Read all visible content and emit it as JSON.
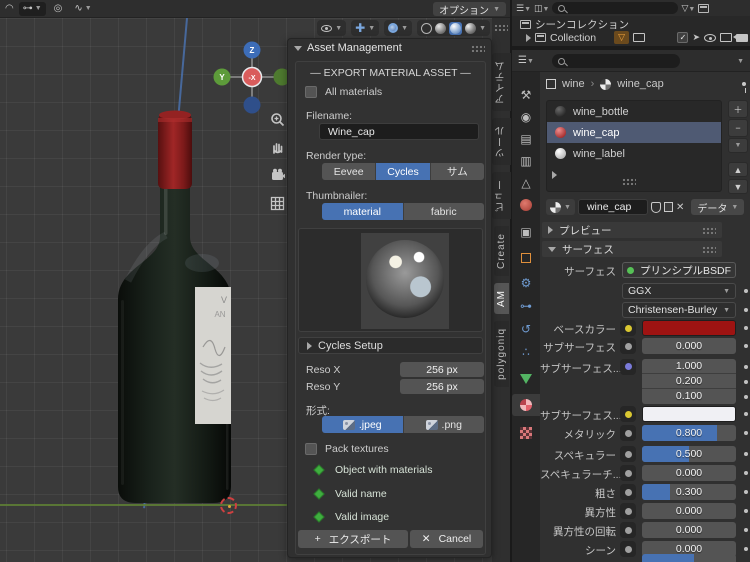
{
  "viewport": {
    "header": {
      "options_button": "オプション",
      "snap_icons": [
        "magnet-icon",
        "snap-target-icon",
        "proportional-editing-icon",
        "falloff-curve-icon"
      ],
      "display_icons": [
        "show-gizmo-icon",
        "show-overlays-icon",
        "toggle-xray-icon"
      ],
      "shading_modes": [
        "wireframe",
        "solid",
        "material-preview",
        "rendered"
      ],
      "active_shading": "material-preview"
    },
    "gizmo": {
      "axis_top": "Z",
      "axis_left": "Y",
      "axis_center": "-X"
    },
    "nav_tools": [
      "zoom-icon",
      "pan-hand-icon",
      "camera-view-icon",
      "grid-ortho-icon"
    ]
  },
  "asset_panel": {
    "title": "Asset Management",
    "section_title": "— EXPORT MATERIAL ASSET —",
    "all_materials_label": "All materials",
    "filename_label": "Filename:",
    "filename_value": "Wine_cap",
    "render_type_label": "Render type:",
    "render_types": [
      "Eevee",
      "Cycles",
      "サム"
    ],
    "render_type_selected": "Cycles",
    "thumbnailer_label": "Thumbnailer:",
    "thumbnailer_options": [
      "material",
      "fabric"
    ],
    "thumbnailer_selected": "material",
    "cycles_setup_label": "Cycles Setup",
    "reso_x_label": "Reso X",
    "reso_x_value": "256 px",
    "reso_y_label": "Reso Y",
    "reso_y_value": "256 px",
    "format_label": "形式:",
    "formats": [
      ".jpeg",
      ".png"
    ],
    "format_selected": ".jpeg",
    "pack_textures_label": "Pack textures",
    "checks": [
      "Object with materials",
      "Valid name",
      "Valid image"
    ],
    "export_label": "エクスポート",
    "cancel_label": "Cancel"
  },
  "side_tabs": {
    "items": [
      "アイテム",
      "ツール",
      "ビュー",
      "Create",
      "AM",
      "polygoniq"
    ],
    "active": "AM"
  },
  "outliner": {
    "scene_collection": "シーンコレクション",
    "collection": "Collection"
  },
  "properties": {
    "breadcrumb": {
      "object": "wine",
      "separator": "›",
      "material": "wine_cap"
    },
    "slots": [
      {
        "name": "wine_bottle",
        "icon": "sphere-dark"
      },
      {
        "name": "wine_cap",
        "icon": "sphere-red"
      },
      {
        "name": "wine_label",
        "icon": "sphere-light"
      }
    ],
    "active_slot": "wine_cap",
    "name_field": "wine_cap",
    "data_menu": "データ",
    "sections": {
      "preview": "プレビュー",
      "surface": "サーフェス"
    },
    "surface_rows": [
      {
        "label": "サーフェス",
        "type": "node_button",
        "value": "プリンシプルBSDF",
        "socket": "#56c156"
      },
      {
        "label": "",
        "type": "dropdown",
        "value": "GGX"
      },
      {
        "label": "",
        "type": "dropdown",
        "value": "Christensen-Burley"
      },
      {
        "label": "ベースカラー",
        "type": "color",
        "color": "#9e1312",
        "socket": "#d9c731"
      },
      {
        "label": "サブサーフェス",
        "type": "slider",
        "value": "0.000",
        "fill": 0,
        "socket": "#a0a0a0"
      },
      {
        "label": "サブサーフェス...",
        "type": "slider",
        "value": "1.000",
        "fill": 0,
        "socket": "#7a7ad9",
        "stack": "top"
      },
      {
        "label": "",
        "type": "slider",
        "value": "0.200",
        "fill": 0,
        "stack": "mid"
      },
      {
        "label": "",
        "type": "slider",
        "value": "0.100",
        "fill": 0,
        "stack": "bottom"
      },
      {
        "label": "サブサーフェス...",
        "type": "color",
        "color": "#f0f0f4",
        "socket": "#d9c731"
      },
      {
        "label": "メタリック",
        "type": "slider",
        "value": "0.800",
        "fill": 80,
        "socket": "#a0a0a0"
      },
      {
        "label": "スペキュラー",
        "type": "slider",
        "value": "0.500",
        "fill": 50,
        "socket": "#a0a0a0"
      },
      {
        "label": "スペキュラーチ...",
        "type": "slider",
        "value": "0.000",
        "fill": 0,
        "socket": "#a0a0a0"
      },
      {
        "label": "粗さ",
        "type": "slider",
        "value": "0.300",
        "fill": 30,
        "socket": "#a0a0a0"
      },
      {
        "label": "異方性",
        "type": "slider",
        "value": "0.000",
        "fill": 0,
        "socket": "#a0a0a0"
      },
      {
        "label": "異方性の回転",
        "type": "slider",
        "value": "0.000",
        "fill": 0,
        "socket": "#a0a0a0"
      },
      {
        "label": "シーン",
        "type": "slider",
        "value": "0.000",
        "fill": 0,
        "socket": "#a0a0a0"
      },
      {
        "label": "",
        "type": "slider",
        "value": "",
        "fill": 55,
        "partial": true
      }
    ],
    "tab_icons": [
      {
        "name": "tool-tab",
        "shape": "glyph",
        "glyph": "⚒",
        "color": "#bdbdbd"
      },
      {
        "name": "render-tab",
        "shape": "glyph",
        "glyph": "◉",
        "color": "#bdbdbd"
      },
      {
        "name": "output-tab",
        "shape": "glyph",
        "glyph": "▤",
        "color": "#bdbdbd"
      },
      {
        "name": "view-layer-tab",
        "shape": "glyph",
        "glyph": "▥",
        "color": "#bdbdbd"
      },
      {
        "name": "scene-tab",
        "shape": "glyph",
        "glyph": "△",
        "color": "#bdbdbd"
      },
      {
        "name": "world-tab",
        "shape": "world"
      },
      {
        "name": "collection-tab",
        "shape": "glyph",
        "glyph": "▣",
        "color": "#bdbdbd"
      },
      {
        "name": "object-tab",
        "shape": "square"
      },
      {
        "name": "modifiers-tab",
        "shape": "glyph",
        "glyph": "⚙",
        "color": "#6f9bd1"
      },
      {
        "name": "constraints-tab",
        "shape": "glyph",
        "glyph": "⊶",
        "color": "#6f9bd1"
      },
      {
        "name": "physics-tab",
        "shape": "glyph",
        "glyph": "↺",
        "color": "#6f9bd1"
      },
      {
        "name": "particles-tab",
        "shape": "glyph",
        "glyph": "∴",
        "color": "#6f9bd1"
      },
      {
        "name": "object-data-tab",
        "shape": "tri"
      },
      {
        "name": "material-tab",
        "shape": "pie",
        "active": true
      },
      {
        "name": "texture-tab",
        "shape": "checker"
      }
    ]
  },
  "colors": {
    "accent": "#4772b3",
    "base_color": "#9e1312",
    "subsurface_color": "#f0f0f4"
  }
}
